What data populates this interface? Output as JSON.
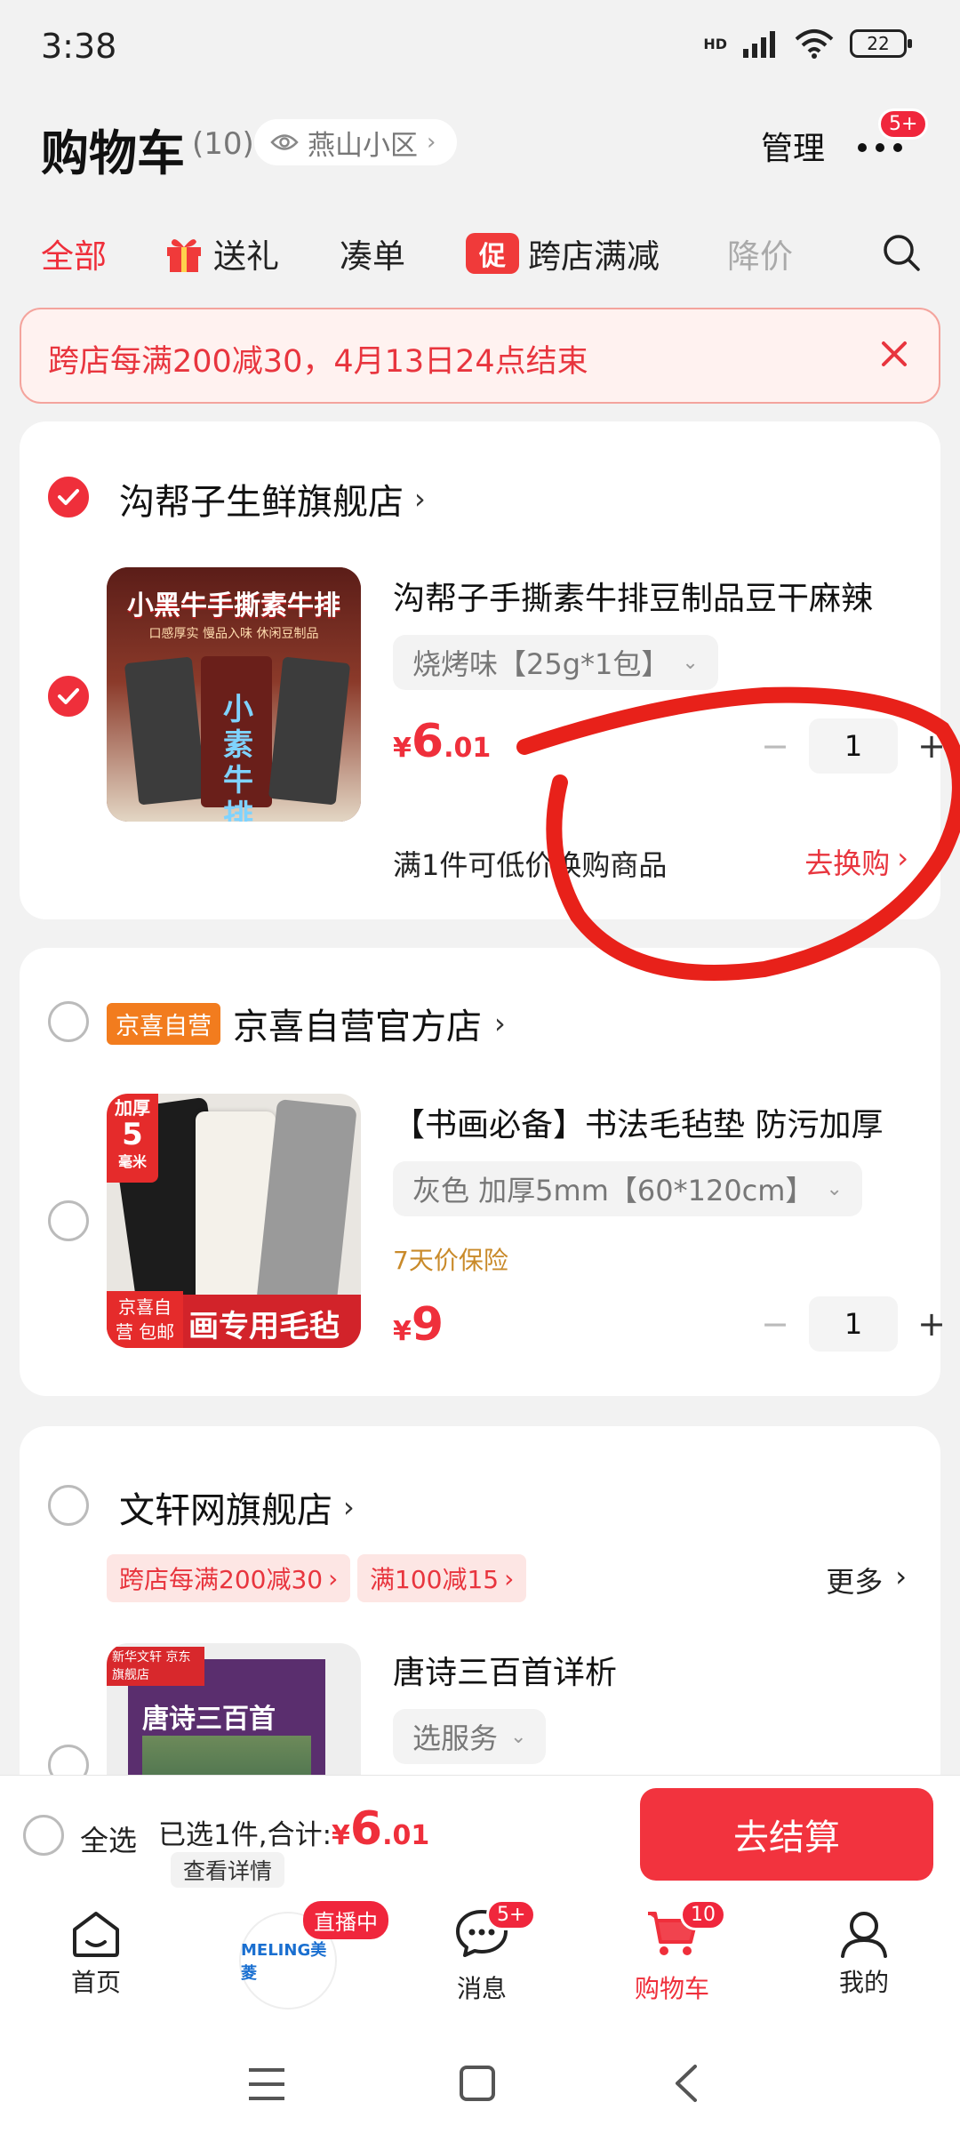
{
  "status_bar": {
    "time": "3:38",
    "network": "HD",
    "battery": "22"
  },
  "header": {
    "title": "购物车",
    "count": "(10)",
    "location": "燕山小区",
    "manage": "管理",
    "more_badge": "5+"
  },
  "tabs": [
    {
      "label": "全部"
    },
    {
      "label": "送礼"
    },
    {
      "label": "凑单"
    },
    {
      "label": "跨店满减",
      "tag": "促"
    },
    {
      "label": "降价"
    }
  ],
  "banner": {
    "text": "跨店每满200减30，4月13日24点结束"
  },
  "stores": [
    {
      "name": "沟帮子生鲜旗舰店",
      "item": {
        "title": "沟帮子手撕素牛排豆制品豆干麻辣",
        "spec": "烧烤味【25g*1包】",
        "price_symbol": "¥",
        "price_int": "6",
        "price_dec": ".01",
        "qty": "1",
        "thumb_text": "小黑牛手撕素牛排",
        "thumb_sub": "口感厚实 慢品入味 休闲豆制品",
        "thumb_pack": "小素牛排"
      },
      "exchange_text": "满1件可低价换购商品",
      "exchange_link": "去换购"
    },
    {
      "tag": "京喜自营",
      "name": "京喜自营官方店",
      "item": {
        "title": "【书画必备】书法毛毡垫 防污加厚",
        "spec": "灰色 加厚5mm【60*120cm】",
        "guarantee": "7天价保险",
        "price_symbol": "¥",
        "price_int": "9",
        "qty": "1",
        "thumb_corner_top": "加厚",
        "thumb_corner_mid": "5",
        "thumb_corner_small": "毫米",
        "thumb_corner_bottom": "京喜自营 包邮",
        "thumb_banner": "画专用毛毡"
      }
    },
    {
      "name": "文轩网旗舰店",
      "coupons": [
        "跨店每满200减30",
        "满100减15"
      ],
      "more": "更多",
      "item": {
        "title": "唐诗三百首详析",
        "spec": "选服务",
        "thumb_tag": "新华文轩 京东旗舰店",
        "thumb_title": "唐诗三百首"
      }
    }
  ],
  "checkout": {
    "select_all": "全选",
    "summary": "已选1件,合计:",
    "price_symbol": "¥",
    "price_int": "6",
    "price_dec": ".01",
    "details": "查看详情",
    "pay": "去结算"
  },
  "nav": {
    "items": [
      {
        "label": "首页"
      },
      {
        "label": "",
        "live": "直播中",
        "brand": "MELING美菱"
      },
      {
        "label": "消息",
        "badge": "5+"
      },
      {
        "label": "购物车",
        "badge": "10"
      },
      {
        "label": "我的"
      }
    ]
  },
  "colors": {
    "accent": "#ef2f3b",
    "orange_tag": "#f27c1e",
    "guarantee": "#c98a2a"
  }
}
